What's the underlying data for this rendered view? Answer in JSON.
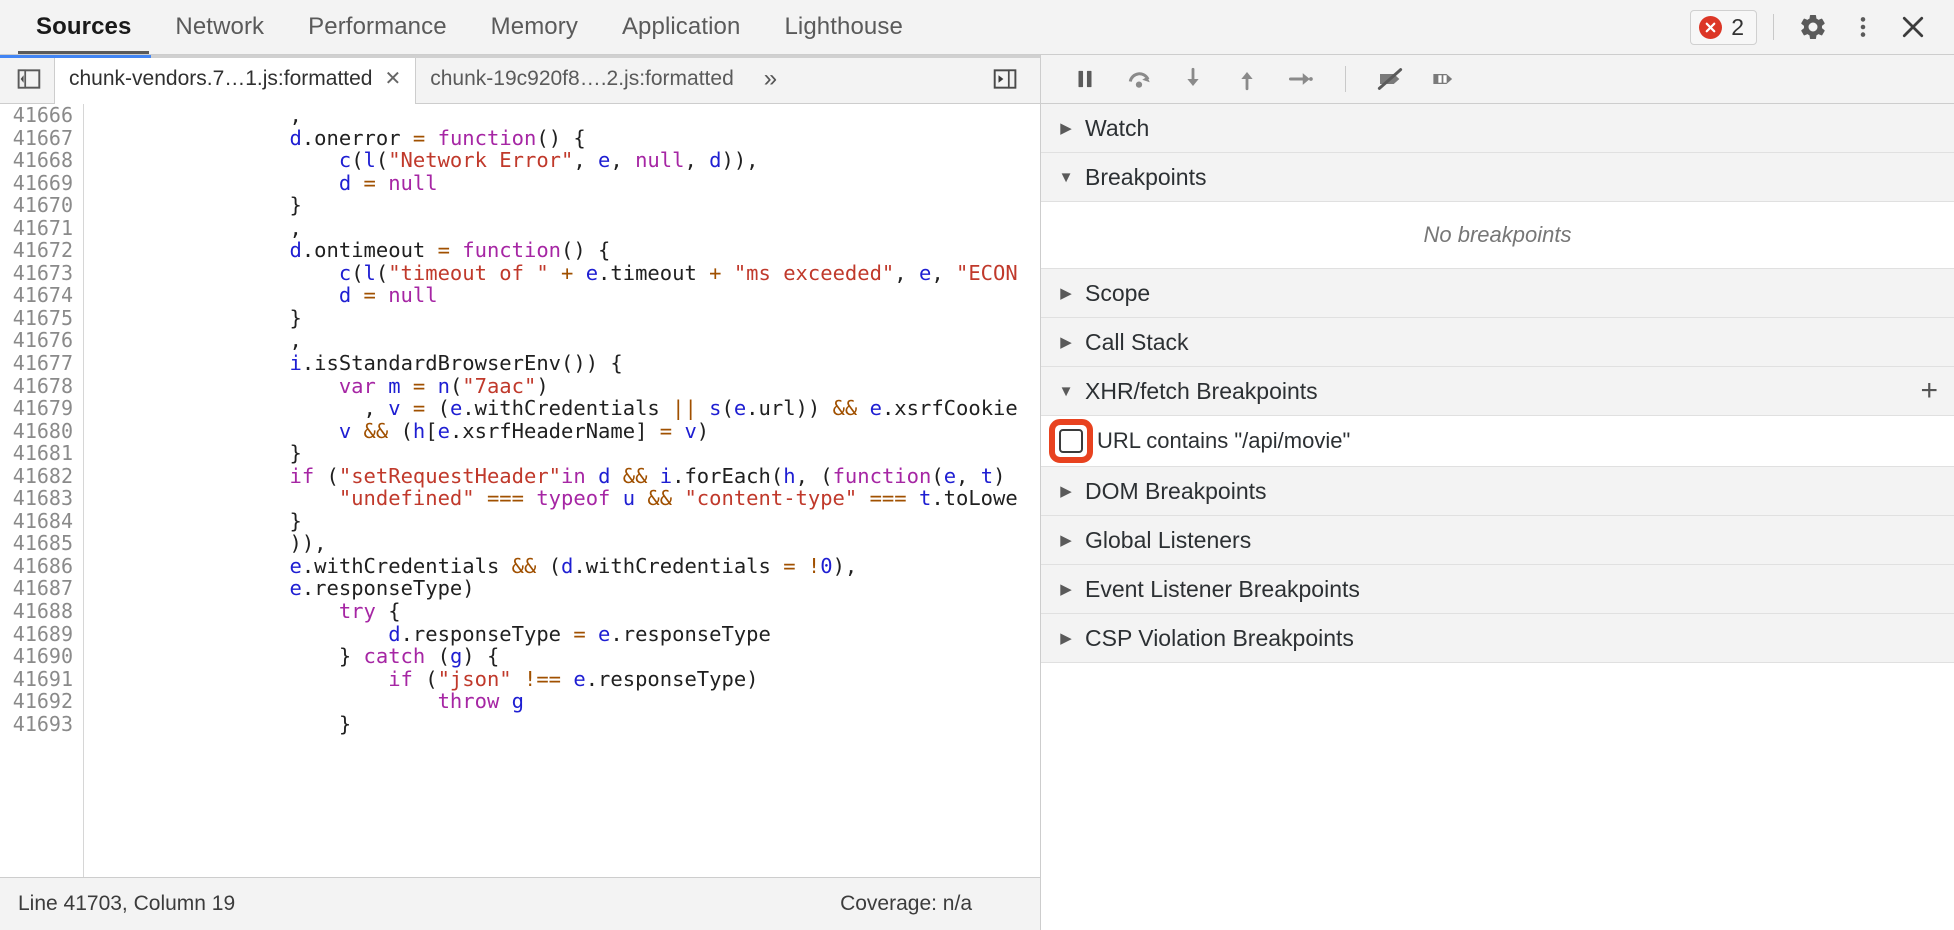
{
  "top_bar": {
    "panel_tabs": [
      {
        "label": "Sources",
        "active": true
      },
      {
        "label": "Network",
        "active": false
      },
      {
        "label": "Performance",
        "active": false
      },
      {
        "label": "Memory",
        "active": false
      },
      {
        "label": "Application",
        "active": false
      },
      {
        "label": "Lighthouse",
        "active": false
      }
    ],
    "error_count": "2",
    "error_color": "#dc3626",
    "settings_icon": "gear-icon",
    "more_icon": "kebab-menu-icon",
    "close_icon": "close-icon"
  },
  "editor": {
    "progress_percent": 14.5,
    "navigator_toggle_icon": "show-navigator-icon",
    "tabs": [
      {
        "label": "chunk-vendors.7…1.js:formatted",
        "active": true,
        "closable": true
      },
      {
        "label": "chunk-19c920f8….2.js:formatted",
        "active": false,
        "closable": false
      }
    ],
    "overflow_label": "»",
    "show_panel_icon": "show-debugger-sidebar-icon",
    "first_line_number": 41666,
    "line_numbers": [
      41666,
      41667,
      41668,
      41669,
      41670,
      41671,
      41672,
      41673,
      41674,
      41675,
      41676,
      41677,
      41678,
      41679,
      41680,
      41681,
      41682,
      41683,
      41684,
      41685,
      41686,
      41687,
      41688,
      41689,
      41690,
      41691,
      41692,
      41693
    ],
    "code_lines": [
      [
        {
          "t": "pl",
          "v": "                ,"
        }
      ],
      [
        {
          "t": "pl",
          "v": "                "
        },
        {
          "t": "id",
          "v": "d"
        },
        {
          "t": "pl",
          "v": "."
        },
        {
          "t": "pl",
          "v": "onerror "
        },
        {
          "t": "op",
          "v": "= "
        },
        {
          "t": "kw",
          "v": "function"
        },
        {
          "t": "pl",
          "v": "() {"
        }
      ],
      [
        {
          "t": "pl",
          "v": "                    "
        },
        {
          "t": "id",
          "v": "c"
        },
        {
          "t": "pl",
          "v": "("
        },
        {
          "t": "id",
          "v": "l"
        },
        {
          "t": "pl",
          "v": "("
        },
        {
          "t": "str",
          "v": "\"Network Error\""
        },
        {
          "t": "pl",
          "v": ", "
        },
        {
          "t": "id",
          "v": "e"
        },
        {
          "t": "pl",
          "v": ", "
        },
        {
          "t": "kw",
          "v": "null"
        },
        {
          "t": "pl",
          "v": ", "
        },
        {
          "t": "id",
          "v": "d"
        },
        {
          "t": "pl",
          "v": ")),"
        }
      ],
      [
        {
          "t": "pl",
          "v": "                    "
        },
        {
          "t": "id",
          "v": "d"
        },
        {
          "t": "pl",
          "v": " "
        },
        {
          "t": "op",
          "v": "= "
        },
        {
          "t": "kw",
          "v": "null"
        }
      ],
      [
        {
          "t": "pl",
          "v": "                }"
        }
      ],
      [
        {
          "t": "pl",
          "v": "                ,"
        }
      ],
      [
        {
          "t": "pl",
          "v": "                "
        },
        {
          "t": "id",
          "v": "d"
        },
        {
          "t": "pl",
          "v": ".ontimeout "
        },
        {
          "t": "op",
          "v": "= "
        },
        {
          "t": "kw",
          "v": "function"
        },
        {
          "t": "pl",
          "v": "() {"
        }
      ],
      [
        {
          "t": "pl",
          "v": "                    "
        },
        {
          "t": "id",
          "v": "c"
        },
        {
          "t": "pl",
          "v": "("
        },
        {
          "t": "id",
          "v": "l"
        },
        {
          "t": "pl",
          "v": "("
        },
        {
          "t": "str",
          "v": "\"timeout of \""
        },
        {
          "t": "pl",
          "v": " "
        },
        {
          "t": "op",
          "v": "+ "
        },
        {
          "t": "id",
          "v": "e"
        },
        {
          "t": "pl",
          "v": ".timeout "
        },
        {
          "t": "op",
          "v": "+ "
        },
        {
          "t": "str",
          "v": "\"ms exceeded\""
        },
        {
          "t": "pl",
          "v": ", "
        },
        {
          "t": "id",
          "v": "e"
        },
        {
          "t": "pl",
          "v": ", "
        },
        {
          "t": "str",
          "v": "\"ECON"
        }
      ],
      [
        {
          "t": "pl",
          "v": "                    "
        },
        {
          "t": "id",
          "v": "d"
        },
        {
          "t": "pl",
          "v": " "
        },
        {
          "t": "op",
          "v": "= "
        },
        {
          "t": "kw",
          "v": "null"
        }
      ],
      [
        {
          "t": "pl",
          "v": "                }"
        }
      ],
      [
        {
          "t": "pl",
          "v": "                ,"
        }
      ],
      [
        {
          "t": "pl",
          "v": "                "
        },
        {
          "t": "id",
          "v": "i"
        },
        {
          "t": "pl",
          "v": ".isStandardBrowserEnv()) {"
        }
      ],
      [
        {
          "t": "pl",
          "v": "                    "
        },
        {
          "t": "kw",
          "v": "var"
        },
        {
          "t": "pl",
          "v": " "
        },
        {
          "t": "id",
          "v": "m"
        },
        {
          "t": "pl",
          "v": " "
        },
        {
          "t": "op",
          "v": "= "
        },
        {
          "t": "id",
          "v": "n"
        },
        {
          "t": "pl",
          "v": "("
        },
        {
          "t": "str",
          "v": "\"7aac\""
        },
        {
          "t": "pl",
          "v": ")"
        }
      ],
      [
        {
          "t": "pl",
          "v": "                      , "
        },
        {
          "t": "id",
          "v": "v"
        },
        {
          "t": "pl",
          "v": " "
        },
        {
          "t": "op",
          "v": "= "
        },
        {
          "t": "pl",
          "v": "("
        },
        {
          "t": "id",
          "v": "e"
        },
        {
          "t": "pl",
          "v": ".withCredentials "
        },
        {
          "t": "op",
          "v": "|| "
        },
        {
          "t": "id",
          "v": "s"
        },
        {
          "t": "pl",
          "v": "("
        },
        {
          "t": "id",
          "v": "e"
        },
        {
          "t": "pl",
          "v": ".url)) "
        },
        {
          "t": "op",
          "v": "&& "
        },
        {
          "t": "id",
          "v": "e"
        },
        {
          "t": "pl",
          "v": ".xsrfCookie"
        }
      ],
      [
        {
          "t": "pl",
          "v": "                    "
        },
        {
          "t": "id",
          "v": "v"
        },
        {
          "t": "pl",
          "v": " "
        },
        {
          "t": "op",
          "v": "&& "
        },
        {
          "t": "pl",
          "v": "("
        },
        {
          "t": "id",
          "v": "h"
        },
        {
          "t": "pl",
          "v": "["
        },
        {
          "t": "id",
          "v": "e"
        },
        {
          "t": "pl",
          "v": ".xsrfHeaderName] "
        },
        {
          "t": "op",
          "v": "= "
        },
        {
          "t": "id",
          "v": "v"
        },
        {
          "t": "pl",
          "v": ")"
        }
      ],
      [
        {
          "t": "pl",
          "v": "                }"
        }
      ],
      [
        {
          "t": "pl",
          "v": "                "
        },
        {
          "t": "kw",
          "v": "if"
        },
        {
          "t": "pl",
          "v": " ("
        },
        {
          "t": "str",
          "v": "\"setRequestHeader\""
        },
        {
          "t": "kw",
          "v": "in"
        },
        {
          "t": "pl",
          "v": " "
        },
        {
          "t": "id",
          "v": "d"
        },
        {
          "t": "pl",
          "v": " "
        },
        {
          "t": "op",
          "v": "&& "
        },
        {
          "t": "id",
          "v": "i"
        },
        {
          "t": "pl",
          "v": ".forEach("
        },
        {
          "t": "id",
          "v": "h"
        },
        {
          "t": "pl",
          "v": ", ("
        },
        {
          "t": "kw",
          "v": "function"
        },
        {
          "t": "pl",
          "v": "("
        },
        {
          "t": "id",
          "v": "e"
        },
        {
          "t": "pl",
          "v": ", "
        },
        {
          "t": "id",
          "v": "t"
        },
        {
          "t": "pl",
          "v": ")"
        }
      ],
      [
        {
          "t": "pl",
          "v": "                    "
        },
        {
          "t": "str",
          "v": "\"undefined\""
        },
        {
          "t": "pl",
          "v": " "
        },
        {
          "t": "op",
          "v": "=== "
        },
        {
          "t": "kw",
          "v": "typeof"
        },
        {
          "t": "pl",
          "v": " "
        },
        {
          "t": "id",
          "v": "u"
        },
        {
          "t": "pl",
          "v": " "
        },
        {
          "t": "op",
          "v": "&& "
        },
        {
          "t": "str",
          "v": "\"content-type\""
        },
        {
          "t": "pl",
          "v": " "
        },
        {
          "t": "op",
          "v": "=== "
        },
        {
          "t": "id",
          "v": "t"
        },
        {
          "t": "pl",
          "v": ".toLowe"
        }
      ],
      [
        {
          "t": "pl",
          "v": "                }"
        }
      ],
      [
        {
          "t": "pl",
          "v": "                )),"
        }
      ],
      [
        {
          "t": "pl",
          "v": "                "
        },
        {
          "t": "id",
          "v": "e"
        },
        {
          "t": "pl",
          "v": ".withCredentials "
        },
        {
          "t": "op",
          "v": "&& "
        },
        {
          "t": "pl",
          "v": "("
        },
        {
          "t": "id",
          "v": "d"
        },
        {
          "t": "pl",
          "v": ".withCredentials "
        },
        {
          "t": "op",
          "v": "= "
        },
        {
          "t": "op",
          "v": "!"
        },
        {
          "t": "num",
          "v": "0"
        },
        {
          "t": "pl",
          "v": "),"
        }
      ],
      [
        {
          "t": "pl",
          "v": "                "
        },
        {
          "t": "id",
          "v": "e"
        },
        {
          "t": "pl",
          "v": ".responseType)"
        }
      ],
      [
        {
          "t": "pl",
          "v": "                    "
        },
        {
          "t": "kw",
          "v": "try"
        },
        {
          "t": "pl",
          "v": " {"
        }
      ],
      [
        {
          "t": "pl",
          "v": "                        "
        },
        {
          "t": "id",
          "v": "d"
        },
        {
          "t": "pl",
          "v": ".responseType "
        },
        {
          "t": "op",
          "v": "= "
        },
        {
          "t": "id",
          "v": "e"
        },
        {
          "t": "pl",
          "v": ".responseType"
        }
      ],
      [
        {
          "t": "pl",
          "v": "                    } "
        },
        {
          "t": "kw",
          "v": "catch"
        },
        {
          "t": "pl",
          "v": " ("
        },
        {
          "t": "id",
          "v": "g"
        },
        {
          "t": "pl",
          "v": ") {"
        }
      ],
      [
        {
          "t": "pl",
          "v": "                        "
        },
        {
          "t": "kw",
          "v": "if"
        },
        {
          "t": "pl",
          "v": " ("
        },
        {
          "t": "str",
          "v": "\"json\""
        },
        {
          "t": "pl",
          "v": " "
        },
        {
          "t": "op",
          "v": "!== "
        },
        {
          "t": "id",
          "v": "e"
        },
        {
          "t": "pl",
          "v": ".responseType)"
        }
      ],
      [
        {
          "t": "pl",
          "v": "                            "
        },
        {
          "t": "kw",
          "v": "throw"
        },
        {
          "t": "pl",
          "v": " "
        },
        {
          "t": "id",
          "v": "g"
        }
      ],
      [
        {
          "t": "pl",
          "v": "                    }"
        }
      ]
    ]
  },
  "status_bar": {
    "position": "Line 41703, Column 19",
    "coverage": "Coverage: n/a"
  },
  "debugger": {
    "toolbar_buttons": [
      {
        "name": "pause-script-execution-button",
        "icon": "pause-icon"
      },
      {
        "name": "step-over-button",
        "icon": "step-over-icon"
      },
      {
        "name": "step-into-button",
        "icon": "step-into-icon"
      },
      {
        "name": "step-out-button",
        "icon": "step-out-icon"
      },
      {
        "name": "step-button",
        "icon": "step-icon"
      },
      {
        "name": "deactivate-breakpoints-button",
        "icon": "deactivate-breakpoints-icon"
      },
      {
        "name": "pause-on-exceptions-button",
        "icon": "pause-on-exceptions-icon"
      }
    ],
    "sections": [
      {
        "title": "Watch",
        "expanded": false
      },
      {
        "title": "Breakpoints",
        "expanded": true,
        "empty_text": "No breakpoints"
      },
      {
        "title": "Scope",
        "expanded": false
      },
      {
        "title": "Call Stack",
        "expanded": false
      },
      {
        "title": "XHR/fetch Breakpoints",
        "expanded": true,
        "has_add": true,
        "add_label": "+"
      },
      {
        "title": "DOM Breakpoints",
        "expanded": false
      },
      {
        "title": "Global Listeners",
        "expanded": false
      },
      {
        "title": "Event Listener Breakpoints",
        "expanded": false
      },
      {
        "title": "CSP Violation Breakpoints",
        "expanded": false
      }
    ],
    "xhr_breakpoints": [
      {
        "label": "URL contains \"/api/movie\"",
        "checked": false,
        "highlighted": true
      }
    ],
    "highlight_color": "#e8421f"
  }
}
